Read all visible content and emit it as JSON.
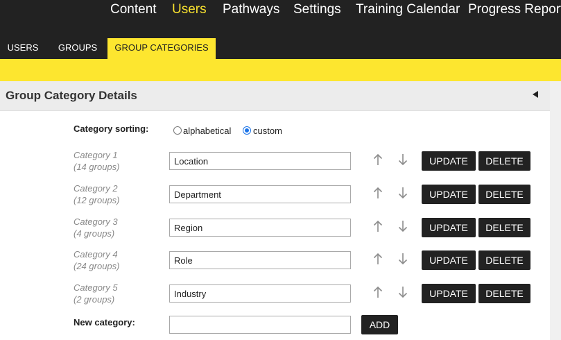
{
  "topnav": {
    "items": [
      {
        "label": "Content"
      },
      {
        "label": "Users"
      },
      {
        "label": "Pathways"
      },
      {
        "label": "Settings"
      },
      {
        "label": "Training Calendar"
      },
      {
        "label": "Progress Reports"
      }
    ],
    "active": "Users"
  },
  "subtabs": {
    "items": [
      {
        "label": "USERS"
      },
      {
        "label": "GROUPS"
      },
      {
        "label": "GROUP CATEGORIES"
      }
    ],
    "active": "GROUP CATEGORIES"
  },
  "section": {
    "title": "Group Category Details",
    "collapse_icon": "triangle-left-icon"
  },
  "sorting": {
    "label": "Category sorting:",
    "options": [
      {
        "label": "alphabetical",
        "checked": false
      },
      {
        "label": "custom",
        "checked": true
      }
    ]
  },
  "categories": [
    {
      "name": "Category 1",
      "count": "(14 groups)",
      "value": "Location"
    },
    {
      "name": "Category 2",
      "count": "(12 groups)",
      "value": "Department"
    },
    {
      "name": "Category 3",
      "count": "(4 groups)",
      "value": "Region"
    },
    {
      "name": "Category 4",
      "count": "(24 groups)",
      "value": "Role"
    },
    {
      "name": "Category 5",
      "count": "(2 groups)",
      "value": "Industry"
    }
  ],
  "row_actions": {
    "update_label": "UPDATE",
    "delete_label": "DELETE",
    "move_up_icon": "arrow-up-icon",
    "move_down_icon": "arrow-down-icon"
  },
  "new_category": {
    "label": "New category:",
    "value": "",
    "add_label": "ADD"
  },
  "colors": {
    "nav_bg": "#222222",
    "accent_yellow": "#fde62f",
    "active_nav_text": "#f8e12f",
    "button_bg": "#222222",
    "header_bg": "#ececec"
  }
}
